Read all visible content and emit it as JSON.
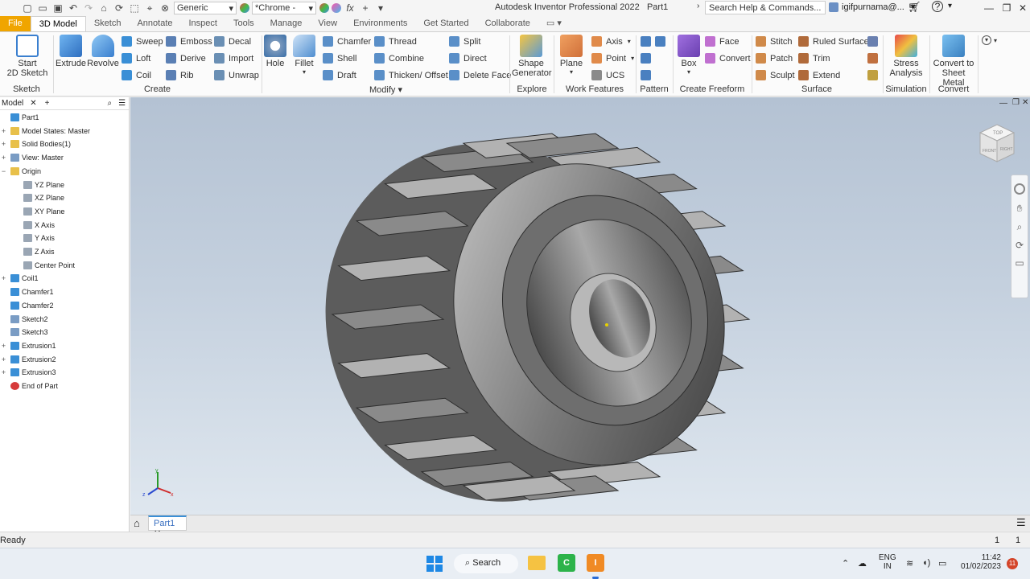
{
  "titlebar": {
    "material": "Generic",
    "appearance": "*Chrome -",
    "title": "Autodesk Inventor Professional 2022",
    "doc": "Part1",
    "search_placeholder": "Search Help & Commands...",
    "user": "igifpurnama@..."
  },
  "tabs": [
    "File",
    "3D Model",
    "Sketch",
    "Annotate",
    "Inspect",
    "Tools",
    "Manage",
    "View",
    "Environments",
    "Get Started",
    "Collaborate"
  ],
  "ribbon": {
    "sketch": {
      "start_l1": "Start",
      "start_l2": "2D Sketch",
      "group": "Sketch"
    },
    "create": {
      "extrude": "Extrude",
      "revolve": "Revolve",
      "sweep": "Sweep",
      "loft": "Loft",
      "coil": "Coil",
      "emboss": "Emboss",
      "derive": "Derive",
      "rib": "Rib",
      "decal": "Decal",
      "import": "Import",
      "unwrap": "Unwrap",
      "group": "Create"
    },
    "modify": {
      "hole": "Hole",
      "fillet": "Fillet",
      "chamfer": "Chamfer",
      "shell": "Shell",
      "draft": "Draft",
      "thread": "Thread",
      "combine": "Combine",
      "thicken": "Thicken/ Offset",
      "split": "Split",
      "direct": "Direct",
      "delete_face": "Delete Face",
      "group": "Modify"
    },
    "explore": {
      "shape_l1": "Shape",
      "shape_l2": "Generator",
      "group": "Explore"
    },
    "work": {
      "plane": "Plane",
      "axis": "Axis",
      "point": "Point",
      "ucs": "UCS",
      "group": "Work Features"
    },
    "pattern": {
      "group": "Pattern"
    },
    "freeform": {
      "box": "Box",
      "face": "Face",
      "convert": "Convert",
      "group": "Create Freeform"
    },
    "surface": {
      "stitch": "Stitch",
      "patch": "Patch",
      "sculpt": "Sculpt",
      "ruled": "Ruled Surface",
      "trim": "Trim",
      "extend": "Extend",
      "group": "Surface"
    },
    "simulation": {
      "stress_l1": "Stress",
      "stress_l2": "Analysis",
      "group": "Simulation"
    },
    "convert": {
      "sheet_l1": "Convert to",
      "sheet_l2": "Sheet Metal",
      "group": "Convert"
    }
  },
  "browser": {
    "tab": "Model",
    "items": [
      {
        "label": "Part1",
        "color": "#3a8fd6"
      },
      {
        "label": "Model States: Master",
        "color": "#e8c04a"
      },
      {
        "label": "Solid Bodies(1)",
        "color": "#e8c04a"
      },
      {
        "label": "View: Master",
        "color": "#7a9cc4"
      },
      {
        "label": "Origin",
        "color": "#e8c04a"
      },
      {
        "label": "YZ Plane",
        "color": "#9aa6b4"
      },
      {
        "label": "XZ Plane",
        "color": "#9aa6b4"
      },
      {
        "label": "XY Plane",
        "color": "#9aa6b4"
      },
      {
        "label": "X Axis",
        "color": "#9aa6b4"
      },
      {
        "label": "Y Axis",
        "color": "#9aa6b4"
      },
      {
        "label": "Z Axis",
        "color": "#9aa6b4"
      },
      {
        "label": "Center Point",
        "color": "#9aa6b4"
      },
      {
        "label": "Coil1",
        "color": "#3a8fd6"
      },
      {
        "label": "Chamfer1",
        "color": "#3a8fd6"
      },
      {
        "label": "Chamfer2",
        "color": "#3a8fd6"
      },
      {
        "label": "Sketch2",
        "color": "#7a9cc4"
      },
      {
        "label": "Sketch3",
        "color": "#7a9cc4"
      },
      {
        "label": "Extrusion1",
        "color": "#3a8fd6"
      },
      {
        "label": "Extrusion2",
        "color": "#3a8fd6"
      },
      {
        "label": "Extrusion3",
        "color": "#3a8fd6"
      },
      {
        "label": "End of Part",
        "color": "#d63a3a"
      }
    ]
  },
  "viewcube": {
    "top": "TOP",
    "front": "FRONT",
    "right": "RIGHT"
  },
  "doc_tab": "Part1",
  "status": {
    "text": "Ready",
    "n1": "1",
    "n2": "1"
  },
  "taskbar": {
    "search": "Search",
    "lang1": "ENG",
    "lang2": "IN",
    "time": "11:42",
    "date": "01/02/2023",
    "badge": "11"
  }
}
